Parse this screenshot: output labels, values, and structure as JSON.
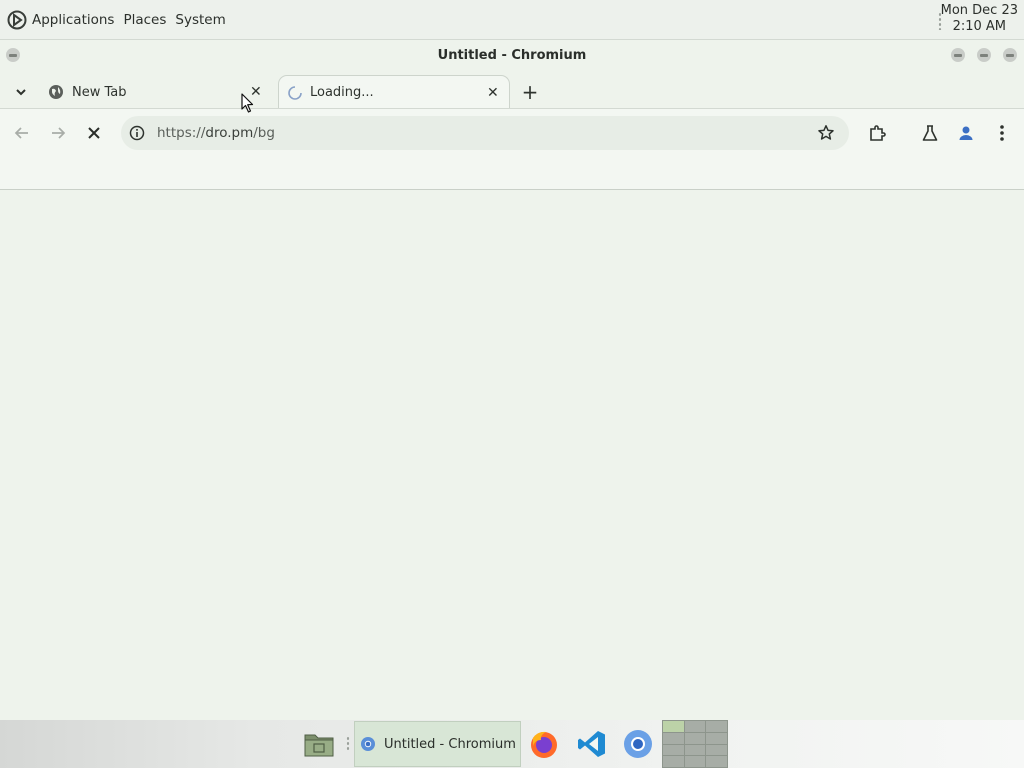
{
  "top_panel": {
    "menus": [
      {
        "label": "Applications"
      },
      {
        "label": "Places"
      },
      {
        "label": "System"
      }
    ],
    "clock": {
      "date": "Mon Dec 23",
      "time": "2:10 AM"
    }
  },
  "window": {
    "title": "Untitled - Chromium"
  },
  "tabs": [
    {
      "label": "New Tab",
      "state": "inactive"
    },
    {
      "label": "Loading...",
      "state": "active-loading"
    }
  ],
  "toolbar": {
    "url_prefix": "https://",
    "url_host": "dro.pm",
    "url_path": "/bg"
  },
  "taskbar": {
    "task_label": "Untitled - Chromium",
    "launchers": [
      "file-manager-icon",
      "firefox-icon",
      "vscode-icon",
      "chromium-icon"
    ]
  },
  "colors": {
    "accent": "#3b6fc4",
    "panel_bg": "#edf1ec",
    "content_bg": "#eef3ec"
  }
}
